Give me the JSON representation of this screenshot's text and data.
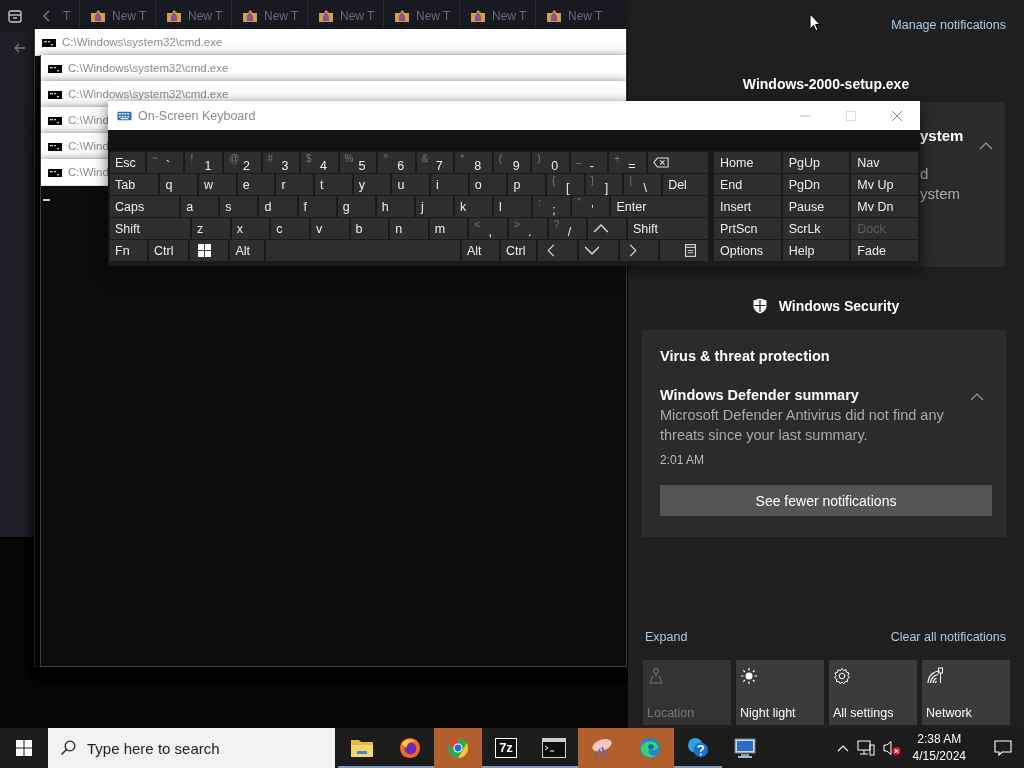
{
  "explorer": {
    "tabs": [
      {
        "label": "T"
      },
      {
        "label": "New T"
      },
      {
        "label": "New T"
      },
      {
        "label": "New T"
      },
      {
        "label": "New T"
      },
      {
        "label": "New T"
      },
      {
        "label": "New T"
      },
      {
        "label": "New T"
      }
    ]
  },
  "cmd_windows": [
    {
      "title": "C:\\Windows\\system32\\cmd.exe"
    },
    {
      "title": "C:\\Windows\\system32\\cmd.exe"
    },
    {
      "title": "C:\\Windows\\system32\\cmd.exe"
    },
    {
      "title": "C:\\Wind"
    },
    {
      "title": "C:\\Wind"
    },
    {
      "title": "C:\\Wind"
    }
  ],
  "keyboard": {
    "title": "On-Screen Keyboard",
    "main_rows": [
      [
        {
          "kind": "char",
          "label": "Esc"
        },
        {
          "kind": "char",
          "label": "`",
          "shift": "~"
        },
        {
          "kind": "char",
          "label": "1",
          "shift": "!"
        },
        {
          "kind": "char",
          "label": "2",
          "shift": "@"
        },
        {
          "kind": "char",
          "label": "3",
          "shift": "#"
        },
        {
          "kind": "char",
          "label": "4",
          "shift": "$"
        },
        {
          "kind": "char",
          "label": "5",
          "shift": "%"
        },
        {
          "kind": "char",
          "label": "6",
          "shift": "^"
        },
        {
          "kind": "char",
          "label": "7",
          "shift": "&"
        },
        {
          "kind": "char",
          "label": "8",
          "shift": "*"
        },
        {
          "kind": "char",
          "label": "9",
          "shift": "("
        },
        {
          "kind": "char",
          "label": "0",
          "shift": ")"
        },
        {
          "kind": "char",
          "label": "-",
          "shift": "_"
        },
        {
          "kind": "char",
          "label": "=",
          "shift": "+"
        },
        {
          "kind": "backspace"
        }
      ],
      [
        {
          "kind": "char",
          "label": "Tab"
        },
        {
          "kind": "char",
          "label": "q"
        },
        {
          "kind": "char",
          "label": "w"
        },
        {
          "kind": "char",
          "label": "e"
        },
        {
          "kind": "char",
          "label": "r"
        },
        {
          "kind": "char",
          "label": "t"
        },
        {
          "kind": "char",
          "label": "y"
        },
        {
          "kind": "char",
          "label": "u"
        },
        {
          "kind": "char",
          "label": "i"
        },
        {
          "kind": "char",
          "label": "o"
        },
        {
          "kind": "char",
          "label": "p"
        },
        {
          "kind": "char",
          "label": "[",
          "shift": "{"
        },
        {
          "kind": "char",
          "label": "]",
          "shift": "}"
        },
        {
          "kind": "char",
          "label": "\\",
          "shift": "|"
        },
        {
          "kind": "char",
          "label": "Del"
        }
      ],
      [
        {
          "kind": "char",
          "label": "Caps"
        },
        {
          "kind": "char",
          "label": "a"
        },
        {
          "kind": "char",
          "label": "s"
        },
        {
          "kind": "char",
          "label": "d"
        },
        {
          "kind": "char",
          "label": "f"
        },
        {
          "kind": "char",
          "label": "g"
        },
        {
          "kind": "char",
          "label": "h"
        },
        {
          "kind": "char",
          "label": "j"
        },
        {
          "kind": "char",
          "label": "k"
        },
        {
          "kind": "char",
          "label": "l"
        },
        {
          "kind": "char",
          "label": ";",
          "shift": ":"
        },
        {
          "kind": "char",
          "label": "'",
          "shift": "\""
        },
        {
          "kind": "char",
          "label": "Enter"
        }
      ],
      [
        {
          "kind": "char",
          "label": "Shift"
        },
        {
          "kind": "char",
          "label": "z"
        },
        {
          "kind": "char",
          "label": "x"
        },
        {
          "kind": "char",
          "label": "c"
        },
        {
          "kind": "char",
          "label": "v"
        },
        {
          "kind": "char",
          "label": "b"
        },
        {
          "kind": "char",
          "label": "n"
        },
        {
          "kind": "char",
          "label": "m"
        },
        {
          "kind": "char",
          "label": ",",
          "shift": "<"
        },
        {
          "kind": "char",
          "label": ".",
          "shift": ">"
        },
        {
          "kind": "char",
          "label": "/",
          "shift": "?"
        },
        {
          "kind": "up"
        },
        {
          "kind": "char",
          "label": "Shift"
        }
      ],
      [
        {
          "kind": "char",
          "label": "Fn"
        },
        {
          "kind": "char",
          "label": "Ctrl"
        },
        {
          "kind": "windows"
        },
        {
          "kind": "char",
          "label": "Alt"
        },
        {
          "kind": "space"
        },
        {
          "kind": "char",
          "label": "Alt"
        },
        {
          "kind": "char",
          "label": "Ctrl"
        },
        {
          "kind": "left"
        },
        {
          "kind": "down"
        },
        {
          "kind": "right"
        },
        {
          "kind": "menu"
        }
      ]
    ],
    "nav_rows": [
      [
        {
          "label": "Home",
          "disabled": false
        },
        {
          "label": "PgUp",
          "disabled": false
        },
        {
          "label": "Nav",
          "disabled": false
        }
      ],
      [
        {
          "label": "End",
          "disabled": false
        },
        {
          "label": "PgDn",
          "disabled": false
        },
        {
          "label": "Mv Up",
          "disabled": false
        }
      ],
      [
        {
          "label": "Insert",
          "disabled": false
        },
        {
          "label": "Pause",
          "disabled": false
        },
        {
          "label": "Mv Dn",
          "disabled": false
        }
      ],
      [
        {
          "label": "PrtScn",
          "disabled": false
        },
        {
          "label": "ScrLk",
          "disabled": false
        },
        {
          "label": "Dock",
          "disabled": true
        }
      ],
      [
        {
          "label": "Options",
          "disabled": false
        },
        {
          "label": "Help",
          "disabled": false
        },
        {
          "label": "Fade",
          "disabled": false
        }
      ]
    ]
  },
  "action_center": {
    "manage": "Manage notifications",
    "setup_group": {
      "app": "Windows-2000-setup.exe",
      "title": "ystem",
      "body_lines": [
        "d",
        "ystem"
      ]
    },
    "security_group": {
      "app": "Windows Security",
      "header": "Virus & threat protection",
      "title": "Windows Defender summary",
      "body": "Microsoft Defender Antivirus did not find any threats since your last summary.",
      "time": "2:01 AM",
      "button": "See fewer notifications"
    },
    "expand": "Expand",
    "clear_all": "Clear all notifications",
    "tiles": [
      {
        "kind": "location",
        "label": "Location",
        "disabled": true
      },
      {
        "kind": "night-light",
        "label": "Night light",
        "disabled": false
      },
      {
        "kind": "settings",
        "label": "All settings",
        "disabled": false
      },
      {
        "kind": "network",
        "label": "Network",
        "disabled": false
      }
    ]
  },
  "taskbar": {
    "search_placeholder": "Type here to search",
    "apps": [
      {
        "kind": "folder",
        "flashing": false,
        "running": true
      },
      {
        "kind": "firefox",
        "flashing": false,
        "running": true
      },
      {
        "kind": "chrome",
        "flashing": true,
        "running": false
      },
      {
        "kind": "archive",
        "label": "7z",
        "flashing": false,
        "running": true
      },
      {
        "kind": "terminal",
        "flashing": false,
        "running": true
      },
      {
        "kind": "dish",
        "flashing": true,
        "running": false
      },
      {
        "kind": "edge",
        "flashing": true,
        "running": false
      },
      {
        "kind": "help",
        "flashing": false,
        "running": true
      },
      {
        "kind": "remote",
        "flashing": false,
        "running": false
      }
    ],
    "time": "2:38 AM",
    "date": "4/15/2024"
  }
}
